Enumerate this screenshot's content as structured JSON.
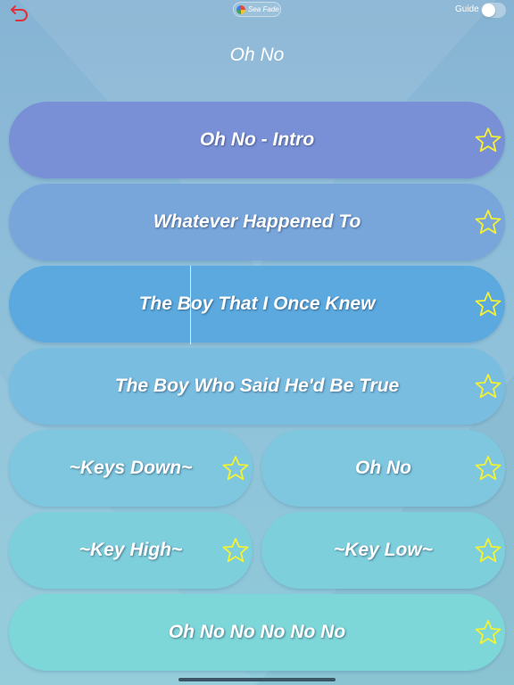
{
  "header": {
    "theme_badge": "Sea Fade",
    "guide_label": "Guide",
    "guide_enabled": false,
    "back_icon": "undo-arrow-icon",
    "badge_icon": "color-wheel-icon"
  },
  "page_title": "Oh No",
  "colors": {
    "star_stroke": "#f4f233",
    "back_icon": "#e0303a"
  },
  "phrases": [
    {
      "label": "Oh No - Intro",
      "color": "#7a90d6",
      "starred": false
    },
    {
      "label": "Whatever Happened To",
      "color": "#78a6db",
      "starred": false
    },
    {
      "label": "The Boy That I Once Knew",
      "color": "#5ba9de",
      "starred": false
    },
    {
      "label": "The Boy Who Said He'd Be True",
      "color": "#79bde0",
      "starred": false
    },
    {
      "label": "~Keys Down~",
      "color": "#7ec7de",
      "starred": false
    },
    {
      "label": "Oh No",
      "color": "#7ec7de",
      "starred": false
    },
    {
      "label": "~Key High~",
      "color": "#7ecfdc",
      "starred": false
    },
    {
      "label": "~Key Low~",
      "color": "#7ecfdc",
      "starred": false
    },
    {
      "label": "Oh No No No No No",
      "color": "#7dd6d8",
      "starred": false
    }
  ]
}
